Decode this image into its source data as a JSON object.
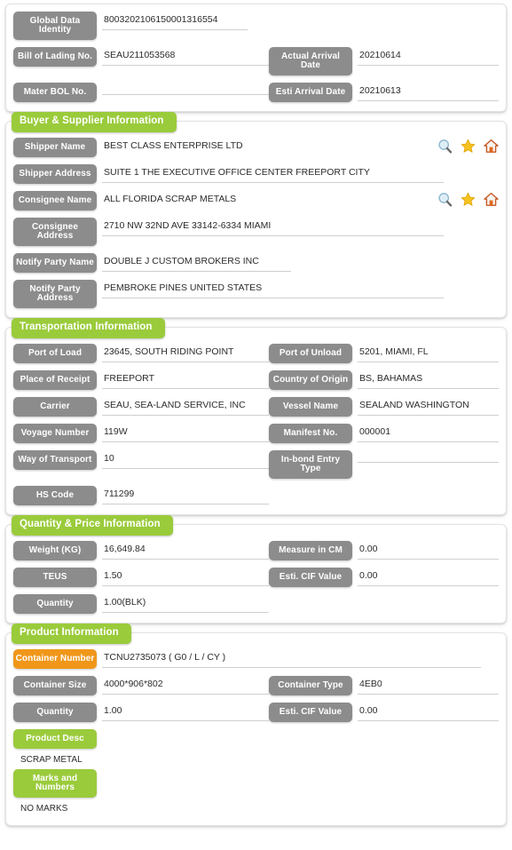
{
  "colors": {
    "green": "#9ACB3B",
    "gray": "#8C8C8C",
    "orange": "#F0971A",
    "text": "#2b2b2b",
    "underline": "#cfcfcf"
  },
  "sections": {
    "identity": {
      "fields": {
        "global_data_identity_label": "Global Data Identity",
        "global_data_identity_value": "8003202106150001316554",
        "bill_of_lading_label": "Bill of Lading No.",
        "bill_of_lading_value": "SEAU211053568",
        "actual_arrival_label": "Actual Arrival Date",
        "actual_arrival_value": "20210614",
        "master_bol_label": "Mater BOL No.",
        "master_bol_value": "",
        "esti_arrival_label": "Esti Arrival Date",
        "esti_arrival_value": "20210613"
      }
    },
    "buyer_supplier": {
      "title": "Buyer & Supplier Information",
      "fields": {
        "shipper_name_label": "Shipper Name",
        "shipper_name_value": "BEST CLASS ENTERPRISE LTD",
        "shipper_address_label": "Shipper Address",
        "shipper_address_value": "SUITE 1 THE EXECUTIVE OFFICE CENTER FREEPORT CITY",
        "consignee_name_label": "Consignee Name",
        "consignee_name_value": "ALL FLORIDA SCRAP METALS",
        "consignee_address_label": "Consignee Address",
        "consignee_address_value": "2710 NW 32ND AVE 33142-6334 MIAMI",
        "notify_party_name_label": "Notify Party Name",
        "notify_party_name_value": "DOUBLE J CUSTOM BROKERS INC",
        "notify_party_address_label": "Notify Party Address",
        "notify_party_address_value": "PEMBROKE PINES UNITED STATES"
      },
      "icons": {
        "search": "search-icon",
        "favorite": "star-icon",
        "company": "home-icon"
      }
    },
    "transportation": {
      "title": "Transportation Information",
      "fields": {
        "port_of_load_label": "Port of Load",
        "port_of_load_value": "23645, SOUTH RIDING POINT",
        "port_of_unload_label": "Port of Unload",
        "port_of_unload_value": "5201, MIAMI, FL",
        "place_of_receipt_label": "Place of Receipt",
        "place_of_receipt_value": "FREEPORT",
        "country_of_origin_label": "Country of Origin",
        "country_of_origin_value": "BS, BAHAMAS",
        "carrier_label": "Carrier",
        "carrier_value": "SEAU, SEA-LAND SERVICE, INC",
        "vessel_name_label": "Vessel Name",
        "vessel_name_value": "SEALAND WASHINGTON",
        "voyage_number_label": "Voyage Number",
        "voyage_number_value": "119W",
        "manifest_no_label": "Manifest No.",
        "manifest_no_value": "000001",
        "way_of_transport_label": "Way of Transport",
        "way_of_transport_value": "10",
        "inbond_entry_type_label": "In-bond Entry Type",
        "inbond_entry_type_value": "",
        "hs_code_label": "HS Code",
        "hs_code_value": "711299"
      }
    },
    "quantity_price": {
      "title": "Quantity & Price Information",
      "fields": {
        "weight_label": "Weight (KG)",
        "weight_value": "16,649.84",
        "measure_label": "Measure in CM",
        "measure_value": "0.00",
        "teus_label": "TEUS",
        "teus_value": "1.50",
        "esti_cif_label": "Esti. CIF Value",
        "esti_cif_value": "0.00",
        "quantity_label": "Quantity",
        "quantity_value": "1.00(BLK)"
      }
    },
    "product": {
      "title": "Product Information",
      "fields": {
        "container_number_label": "Container Number",
        "container_number_value": "TCNU2735073 ( G0 / L / CY )",
        "container_size_label": "Container Size",
        "container_size_value": "4000*906*802",
        "container_type_label": "Container Type",
        "container_type_value": "4EB0",
        "quantity_label": "Quantity",
        "quantity_value": "1.00",
        "esti_cif_label": "Esti. CIF Value",
        "esti_cif_value": "0.00",
        "product_desc_label": "Product Desc",
        "product_desc_value": "SCRAP METAL",
        "marks_numbers_label": "Marks and Numbers",
        "marks_numbers_value": "NO MARKS"
      }
    }
  }
}
